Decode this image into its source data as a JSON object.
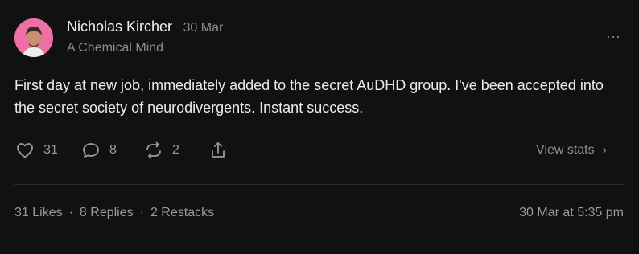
{
  "post": {
    "author": "Nicholas Kircher",
    "date": "30 Mar",
    "publication": "A Chemical Mind",
    "body": "First day at new job, immediately added to the secret AuDHD group. I've been accepted into the secret society of neurodivergents. Instant success.",
    "more_icon": "more-horizontal-icon",
    "more_label": "···"
  },
  "actions": {
    "likes": "31",
    "replies": "8",
    "restacks": "2",
    "like_icon": "heart-icon",
    "reply_icon": "comment-icon",
    "restack_icon": "restack-icon",
    "share_icon": "share-icon",
    "view_stats": "View stats",
    "chevron": "›"
  },
  "stats": {
    "likes_label": "31 Likes",
    "replies_label": "8 Replies",
    "restacks_label": "2 Restacks",
    "separator": "·",
    "timestamp": "30 Mar at 5:35 pm"
  },
  "colors": {
    "background": "#111111",
    "text": "#ececec",
    "muted": "#8e8e8e",
    "avatar_bg": "#ee6fa6"
  }
}
